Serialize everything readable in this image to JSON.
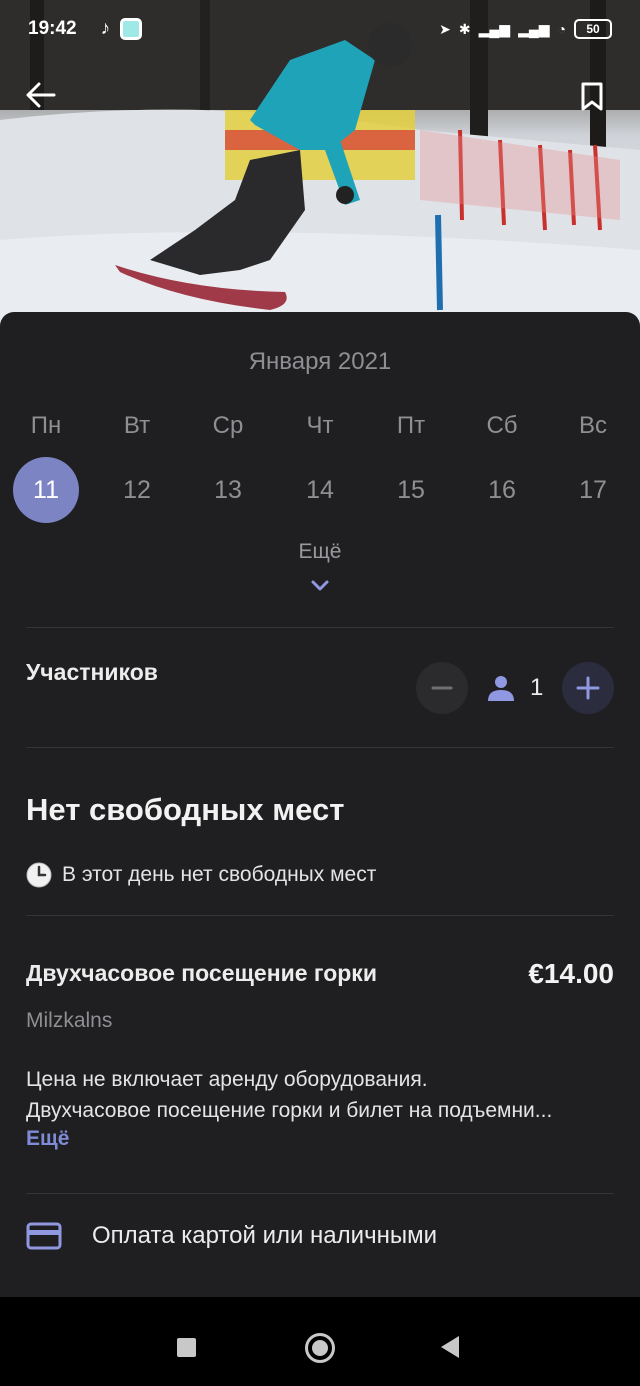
{
  "status_bar": {
    "time": "19:42",
    "battery": "50"
  },
  "hero": {
    "image": "snowboarder-on-slope"
  },
  "calendar": {
    "month_label": "Января 2021",
    "weekdays": [
      "Пн",
      "Вт",
      "Ср",
      "Чт",
      "Пт",
      "Сб",
      "Вс"
    ],
    "days": [
      "11",
      "12",
      "13",
      "14",
      "15",
      "16",
      "17"
    ],
    "selected_day": "11",
    "more_label": "Ещё"
  },
  "participants": {
    "label": "Участников",
    "count": "1"
  },
  "availability": {
    "title": "Нет свободных мест",
    "message": "В этот день нет свободных мест"
  },
  "product": {
    "name": "Двухчасовое посещение горки",
    "price": "€14.00",
    "provider": "Milzkalns",
    "description_line1": "Цена не включает аренду оборудования.",
    "description_line2": "Двухчасовое посещение горки и билет на подъемни...",
    "more_label": "Ещё"
  },
  "payment": {
    "label": "Оплата картой или наличными"
  },
  "colors": {
    "accent": "#7c84c4",
    "link": "#7f8bd6",
    "sheet": "#1f1f21"
  }
}
